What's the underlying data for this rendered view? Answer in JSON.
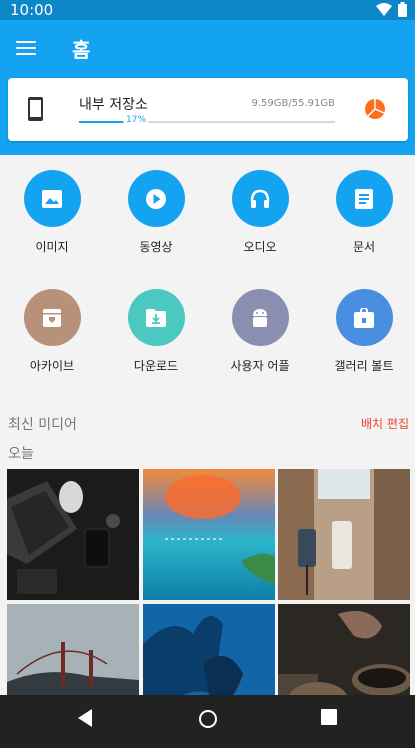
{
  "status_bar": {
    "time": "10:00",
    "wifi_icon": "wifi-icon",
    "battery_icon": "battery-icon"
  },
  "app_bar": {
    "title": "홈",
    "menu_icon": "hamburger-menu-icon"
  },
  "storage": {
    "icon": "phone-icon",
    "label": "내부 저장소",
    "size": "9.59GB/55.91GB",
    "percent_label": "17%",
    "used_fraction": 0.17,
    "chart_icon": "pie-chart-icon"
  },
  "colors": {
    "app_bar": "#13a3f0",
    "status_bar": "#0d86c8",
    "accent_orange": "#ff6d1f",
    "edit_link": "#e8462a"
  },
  "categories": [
    {
      "label": "이미지",
      "icon": "image-icon",
      "color": "#13a3f0"
    },
    {
      "label": "동영상",
      "icon": "play-icon",
      "color": "#13a3f0"
    },
    {
      "label": "오디오",
      "icon": "headphones-icon",
      "color": "#13a3f0"
    },
    {
      "label": "문서",
      "icon": "document-icon",
      "color": "#13a3f0"
    },
    {
      "label": "아카이브",
      "icon": "archive-icon",
      "color": "#b8917a"
    },
    {
      "label": "다운로드",
      "icon": "download-icon",
      "color": "#4bc8c0"
    },
    {
      "label": "사용자 어플",
      "icon": "android-icon",
      "color": "#8a8fb1"
    },
    {
      "label": "갤러리 볼트",
      "icon": "vault-icon",
      "color": "#4a8ee2"
    }
  ],
  "recent_media": {
    "title": "최신 미디어",
    "edit_label": "배치 편집",
    "group_label": "오늘"
  },
  "nav": {
    "back_icon": "back-icon",
    "home_icon": "home-icon",
    "recents_icon": "recents-icon"
  }
}
